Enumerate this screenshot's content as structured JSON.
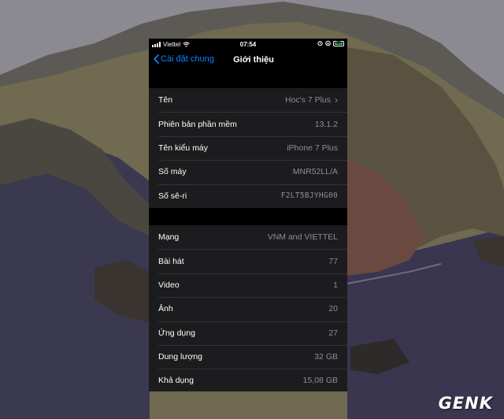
{
  "status_bar": {
    "carrier": "Viettel",
    "time": "07:54",
    "battery_level": "85"
  },
  "nav": {
    "back_label": "Cài đặt chung",
    "title": "Giới thiệu"
  },
  "group1": [
    {
      "label": "Tên",
      "value": "Hoc's 7 Plus"
    },
    {
      "label": "Phiên bản phần mềm",
      "value": "13.1.2"
    },
    {
      "label": "Tên kiểu máy",
      "value": "iPhone 7 Plus"
    },
    {
      "label": "Số máy",
      "value": "MNR52LL/A"
    },
    {
      "label": "Số sê-ri",
      "value": "F2LT5BJYHG00"
    }
  ],
  "group2": [
    {
      "label": "Mạng",
      "value": "VNM and VIETTEL"
    },
    {
      "label": "Bài hát",
      "value": "77"
    },
    {
      "label": "Video",
      "value": "1"
    },
    {
      "label": "Ảnh",
      "value": "20"
    },
    {
      "label": "Ứng dụng",
      "value": "27"
    },
    {
      "label": "Dung lượng",
      "value": "32 GB"
    },
    {
      "label": "Khả dụng",
      "value": "15,08 GB"
    }
  ],
  "watermark": "GENK",
  "colors": {
    "accent": "#0a84ff",
    "row_bg": "#1c1c1e",
    "secondary_text": "#8e8e93",
    "battery": "#34c759"
  }
}
